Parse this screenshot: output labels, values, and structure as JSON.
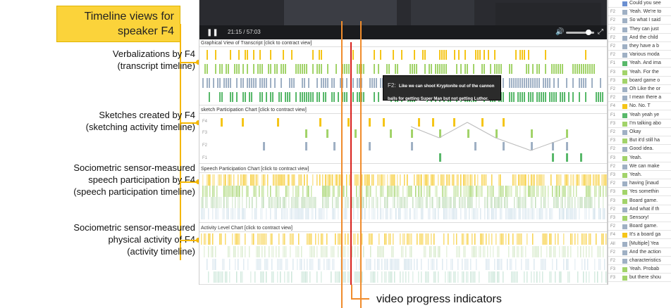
{
  "callout": "Timeline views for speaker F4",
  "annotations": [
    {
      "text": "Verbalizations by F4\n(transcript timeline)"
    },
    {
      "text": "Sketches created by F4\n(sketching activity timeline)"
    },
    {
      "text": "Sociometric sensor-measured\nspeech participation by F4\n(speech participation timeline)"
    },
    {
      "text": "Sociometric sensor-measured\nphysical activity of F4\n(activity timeline)"
    }
  ],
  "video": {
    "time": "21:15 / 57:03",
    "play_icon": "pause-icon",
    "volume_icon": "speaker-icon",
    "fullscreen_icon": "expand-icon"
  },
  "sections": {
    "transcript": "Graphical View of Transcript [click to contract view]",
    "sketch": "sketch Participation Chart [click to contract view]",
    "speech": "Speech Participation Chart [click to contract view]",
    "activity": "Activity Level Chart [click to contract view]"
  },
  "sketch_speakers": [
    "F4",
    "F3",
    "F2",
    "F1"
  ],
  "popup": {
    "speaker": "F2:",
    "text": "Like we can shoot Kryptonite out of the cannon balls for getting Super Man but not getting Luthor."
  },
  "transcript_rows": [
    {
      "spk": "",
      "text": "Could you see",
      "color": "#6b8fd1"
    },
    {
      "spk": "F2",
      "text": "Yeah. We're to",
      "color": "#9fb0c4"
    },
    {
      "spk": "F2",
      "text": "So what I said",
      "color": "#9fb0c4"
    },
    {
      "spk": "F2",
      "text": "They can just",
      "color": "#9fb0c4"
    },
    {
      "spk": "F2",
      "text": "And the child",
      "color": "#9fb0c4"
    },
    {
      "spk": "F2",
      "text": "they have a b",
      "color": "#9fb0c4"
    },
    {
      "spk": "F2",
      "text": "Various moda",
      "color": "#9fb0c4"
    },
    {
      "spk": "F1",
      "text": "Yeah. And ima",
      "color": "#58b86a"
    },
    {
      "spk": "F3",
      "text": "Yeah. For the",
      "color": "#a2d36a"
    },
    {
      "spk": "F3",
      "text": "board game o",
      "color": "#a2d36a"
    },
    {
      "spk": "F2",
      "text": "Oh Like the or",
      "color": "#9fb0c4"
    },
    {
      "spk": "F2",
      "text": "I mean there a",
      "color": "#9fb0c4"
    },
    {
      "spk": "F4",
      "text": "No. No. T",
      "color": "#f5c518"
    },
    {
      "spk": "F1",
      "text": "Yeah yeah ye",
      "color": "#58b86a"
    },
    {
      "spk": "F3",
      "text": "I'm talking abo",
      "color": "#a2d36a"
    },
    {
      "spk": "F2",
      "text": "Okay",
      "color": "#9fb0c4"
    },
    {
      "spk": "F3",
      "text": "But it'd still ha",
      "color": "#a2d36a"
    },
    {
      "spk": "F2",
      "text": "Good idea.",
      "color": "#9fb0c4"
    },
    {
      "spk": "F3",
      "text": "Yeah.",
      "color": "#a2d36a"
    },
    {
      "spk": "F2",
      "text": "We can make",
      "color": "#9fb0c4"
    },
    {
      "spk": "F3",
      "text": "Yeah.",
      "color": "#a2d36a"
    },
    {
      "spk": "F2",
      "text": "having [inaud",
      "color": "#9fb0c4"
    },
    {
      "spk": "F3",
      "text": "Yes somethin",
      "color": "#a2d36a"
    },
    {
      "spk": "F3",
      "text": "Board game.",
      "color": "#a2d36a"
    },
    {
      "spk": "F2",
      "text": "And what if th",
      "color": "#9fb0c4"
    },
    {
      "spk": "F3",
      "text": "Sensory!",
      "color": "#a2d36a"
    },
    {
      "spk": "F2",
      "text": "Board game.",
      "color": "#9fb0c4"
    },
    {
      "spk": "F4",
      "text": "It's a board ga",
      "color": "#f5c518"
    },
    {
      "spk": "All",
      "text": "[Multiple] Yea",
      "color": "#9fb0c4"
    },
    {
      "spk": "F2",
      "text": "And the action",
      "color": "#9fb0c4"
    },
    {
      "spk": "F2",
      "text": "characteristics",
      "color": "#9fb0c4"
    },
    {
      "spk": "F3",
      "text": "Yeah. Probab",
      "color": "#a2d36a"
    },
    {
      "spk": "F3",
      "text": "but there shou",
      "color": "#a2d36a"
    }
  ],
  "progress_caption": "video progress indicators",
  "colors": {
    "F4": "#f5c518",
    "F3": "#a2d36a",
    "F2": "#9fb0c4",
    "F1": "#58b86a",
    "accent": "#f08c2c",
    "marker": "#d8201c"
  }
}
